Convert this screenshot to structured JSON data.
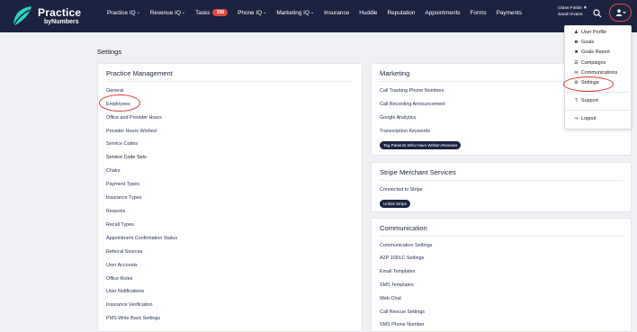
{
  "brand": {
    "line1": "Practice",
    "line2": "byNumbers"
  },
  "nav": {
    "items": [
      {
        "label": "Practice IQ",
        "chevron": true
      },
      {
        "label": "Revenue IQ",
        "chevron": true
      },
      {
        "label": "Tasks",
        "badge": "306"
      },
      {
        "label": "Phone IQ",
        "chevron": true
      },
      {
        "label": "Marketing IQ",
        "chevron": true
      },
      {
        "label": "Insurance"
      },
      {
        "label": "Huddle"
      },
      {
        "label": "Reputation"
      },
      {
        "label": "Appointments"
      },
      {
        "label": "Forms"
      },
      {
        "label": "Payments"
      }
    ],
    "tasks_badge": "306"
  },
  "user": {
    "practice": "Glass-Fields ▼",
    "name": "Sarah Evans"
  },
  "page": {
    "title": "Settings"
  },
  "practice_management": {
    "title": "Practice Management",
    "links": [
      "General",
      "Employees",
      "Office and Provider Hours",
      "Provider Hours Worked",
      "Service Codes",
      "Service Code Sets",
      "Chairs",
      "Payment Types",
      "Insurance Types",
      "Reasons",
      "Recall Types",
      "Appointment Confirmation Status",
      "Referral Sources",
      "User Accounts",
      "Office Roles",
      "User Notifications",
      "Insurance Verification",
      "PMS Write Back Settings"
    ]
  },
  "marketing": {
    "title": "Marketing",
    "links": [
      "Call Tracking Phone Numbers",
      "Call Recording Announcement",
      "Google Analytics",
      "Transcription Keywords"
    ],
    "pill": "Tag Patients Who Have Written Reviews"
  },
  "stripe": {
    "title": "Stripe Merchant Services",
    "status": "Connected to Stripe",
    "button": "Unlink Stripe"
  },
  "communication": {
    "title": "Communication",
    "links": [
      "Communication Settings",
      "A2P 10DLC Settings",
      "Email Templates",
      "SMS Templates",
      "Web Chat",
      "Call Rescue Settings",
      "SMS Phone Number"
    ]
  },
  "user_menu": {
    "items": [
      {
        "label": "User Profile",
        "icon": "user-icon"
      },
      {
        "label": "Goals",
        "icon": "trophy-icon"
      },
      {
        "label": "Goals Report",
        "icon": "report-icon"
      },
      {
        "label": "Campaigns",
        "icon": "list-icon"
      },
      {
        "label": "Communications",
        "icon": "envelope-icon"
      },
      {
        "label": "Settings",
        "icon": "gear-icon"
      },
      {
        "label": "Support",
        "icon": "question-icon"
      },
      {
        "label": "Logout",
        "icon": "logout-icon"
      }
    ]
  },
  "colors": {
    "navbar": "#1b2340",
    "badge": "#e0473e",
    "annotation": "#e03535"
  }
}
